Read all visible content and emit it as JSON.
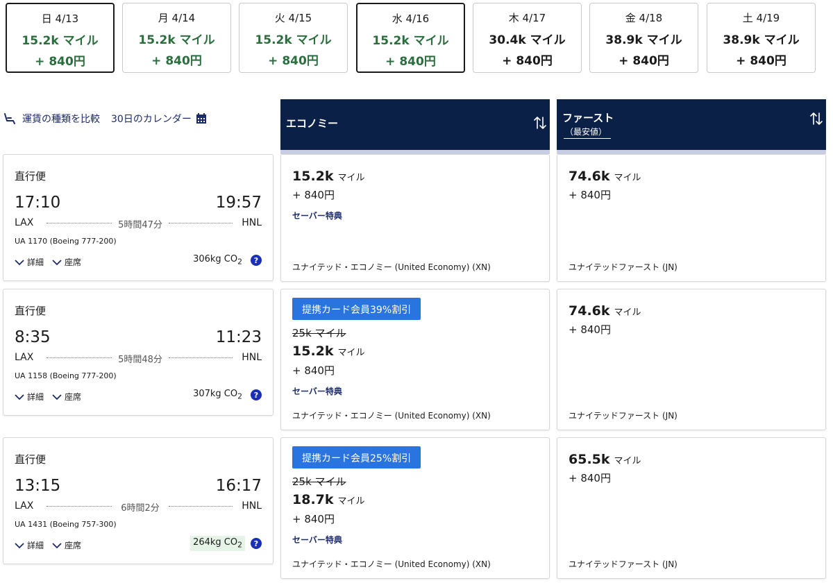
{
  "date_strip": [
    {
      "label": "日 4/13",
      "miles": "15.2k マイル",
      "fee": "+ 840円",
      "color": "#2a6e3d",
      "selected": true
    },
    {
      "label": "月 4/14",
      "miles": "15.2k マイル",
      "fee": "+ 840円",
      "color": "#2a6e3d",
      "selected": false
    },
    {
      "label": "火 4/15",
      "miles": "15.2k マイル",
      "fee": "+ 840円",
      "color": "#2a6e3d",
      "selected": false
    },
    {
      "label": "水 4/16",
      "miles": "15.2k マイル",
      "fee": "+ 840円",
      "color": "#2a6e3d",
      "selected": true
    },
    {
      "label": "木 4/17",
      "miles": "30.4k マイル",
      "fee": "+ 840円",
      "color": "#1a1a1a",
      "selected": false
    },
    {
      "label": "金 4/18",
      "miles": "38.9k マイル",
      "fee": "+ 840円",
      "color": "#1a1a1a",
      "selected": false
    },
    {
      "label": "土 4/19",
      "miles": "38.9k マイル",
      "fee": "+ 840円",
      "color": "#1a1a1a",
      "selected": false
    }
  ],
  "toolbar": {
    "compare_label": "運賃の種類を比較",
    "calendar_label": "30日のカレンダー",
    "seat_icon": "seat-icon",
    "calendar_icon": "calendar-icon"
  },
  "columns": {
    "economy": {
      "name": "エコノミー"
    },
    "first": {
      "name": "ファースト",
      "subtitle": "（最安値）"
    }
  },
  "colors": {
    "header_bg": "#0b2046",
    "header_accent": "#c8cde4",
    "link": "#1b2a6b",
    "badge": "#2a74e0",
    "green": "#2a6e3d"
  },
  "flights": [
    {
      "type": "直行便",
      "depart": "17:10",
      "arrive": "19:57",
      "from": "LAX",
      "to": "HNL",
      "duration": "5時間47分",
      "flight_no": "UA 1170 (Boeing 777-200)",
      "details_label": "詳細",
      "seats_label": "座席",
      "co2": "306kg CO",
      "co2_sub": "2",
      "co2_low": false,
      "economy": {
        "badge": "",
        "original": "",
        "miles": "15.2k",
        "miles_unit": "マイル",
        "fee": "+ 840円",
        "saver": "セーバー特典",
        "cabin": "ユナイテッド・エコノミー (United Economy) (XN)"
      },
      "first": {
        "miles": "74.6k",
        "miles_unit": "マイル",
        "fee": "+ 840円",
        "cabin": "ユナイテッドファースト (JN)"
      }
    },
    {
      "type": "直行便",
      "depart": "8:35",
      "arrive": "11:23",
      "from": "LAX",
      "to": "HNL",
      "duration": "5時間48分",
      "flight_no": "UA 1158 (Boeing 777-200)",
      "details_label": "詳細",
      "seats_label": "座席",
      "co2": "307kg CO",
      "co2_sub": "2",
      "co2_low": false,
      "economy": {
        "badge": "提携カード会員39%割引",
        "original": "25k マイル",
        "miles": "15.2k",
        "miles_unit": "マイル",
        "fee": "+ 840円",
        "saver": "セーバー特典",
        "cabin": "ユナイテッド・エコノミー (United Economy) (XN)"
      },
      "first": {
        "miles": "74.6k",
        "miles_unit": "マイル",
        "fee": "+ 840円",
        "cabin": "ユナイテッドファースト (JN)"
      }
    },
    {
      "type": "直行便",
      "depart": "13:15",
      "arrive": "16:17",
      "from": "LAX",
      "to": "HNL",
      "duration": "6時間2分",
      "flight_no": "UA 1431 (Boeing 757-300)",
      "details_label": "詳細",
      "seats_label": "座席",
      "co2": "264kg CO",
      "co2_sub": "2",
      "co2_low": true,
      "economy": {
        "badge": "提携カード会員25%割引",
        "original": "25k マイル",
        "miles": "18.7k",
        "miles_unit": "マイル",
        "fee": "+ 840円",
        "saver": "セーバー特典",
        "cabin": "ユナイテッド・エコノミー (United Economy) (XN)"
      },
      "first": {
        "miles": "65.5k",
        "miles_unit": "マイル",
        "fee": "+ 840円",
        "cabin": "ユナイテッドファースト (JN)"
      }
    }
  ]
}
